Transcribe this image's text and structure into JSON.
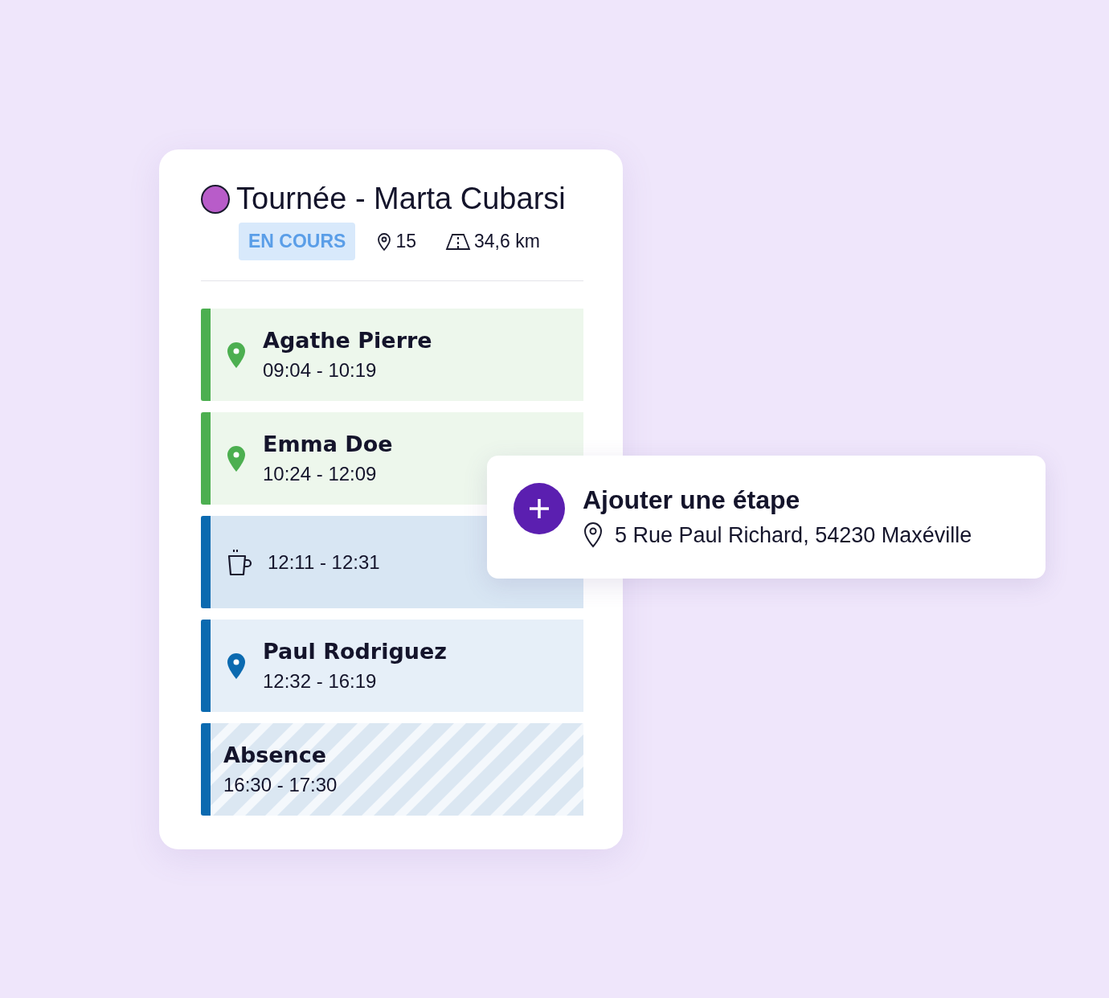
{
  "tour": {
    "title": "Tournée - Marta Cubarsi",
    "color": "#b85cc9",
    "status": "EN COURS",
    "stops": "15",
    "distance": "34,6 km"
  },
  "items": [
    {
      "kind": "visit",
      "name": "Agathe Pierre",
      "time": "09:04 - 10:19",
      "color": "#4caf50"
    },
    {
      "kind": "visit",
      "name": "Emma Doe",
      "time": "10:24 - 12:09",
      "color": "#4caf50"
    },
    {
      "kind": "break",
      "time": "12:11 - 12:31",
      "color": "#0b6ab0"
    },
    {
      "kind": "visit",
      "name": "Paul Rodriguez",
      "time": "12:32 - 16:19",
      "color": "#0b6ab0"
    },
    {
      "kind": "absence",
      "name": "Absence",
      "time": "16:30 - 17:30",
      "color": "#0b6ab0"
    }
  ],
  "popup": {
    "title": "Ajouter une étape",
    "address": "5 Rue Paul Richard, 54230 Maxéville"
  }
}
